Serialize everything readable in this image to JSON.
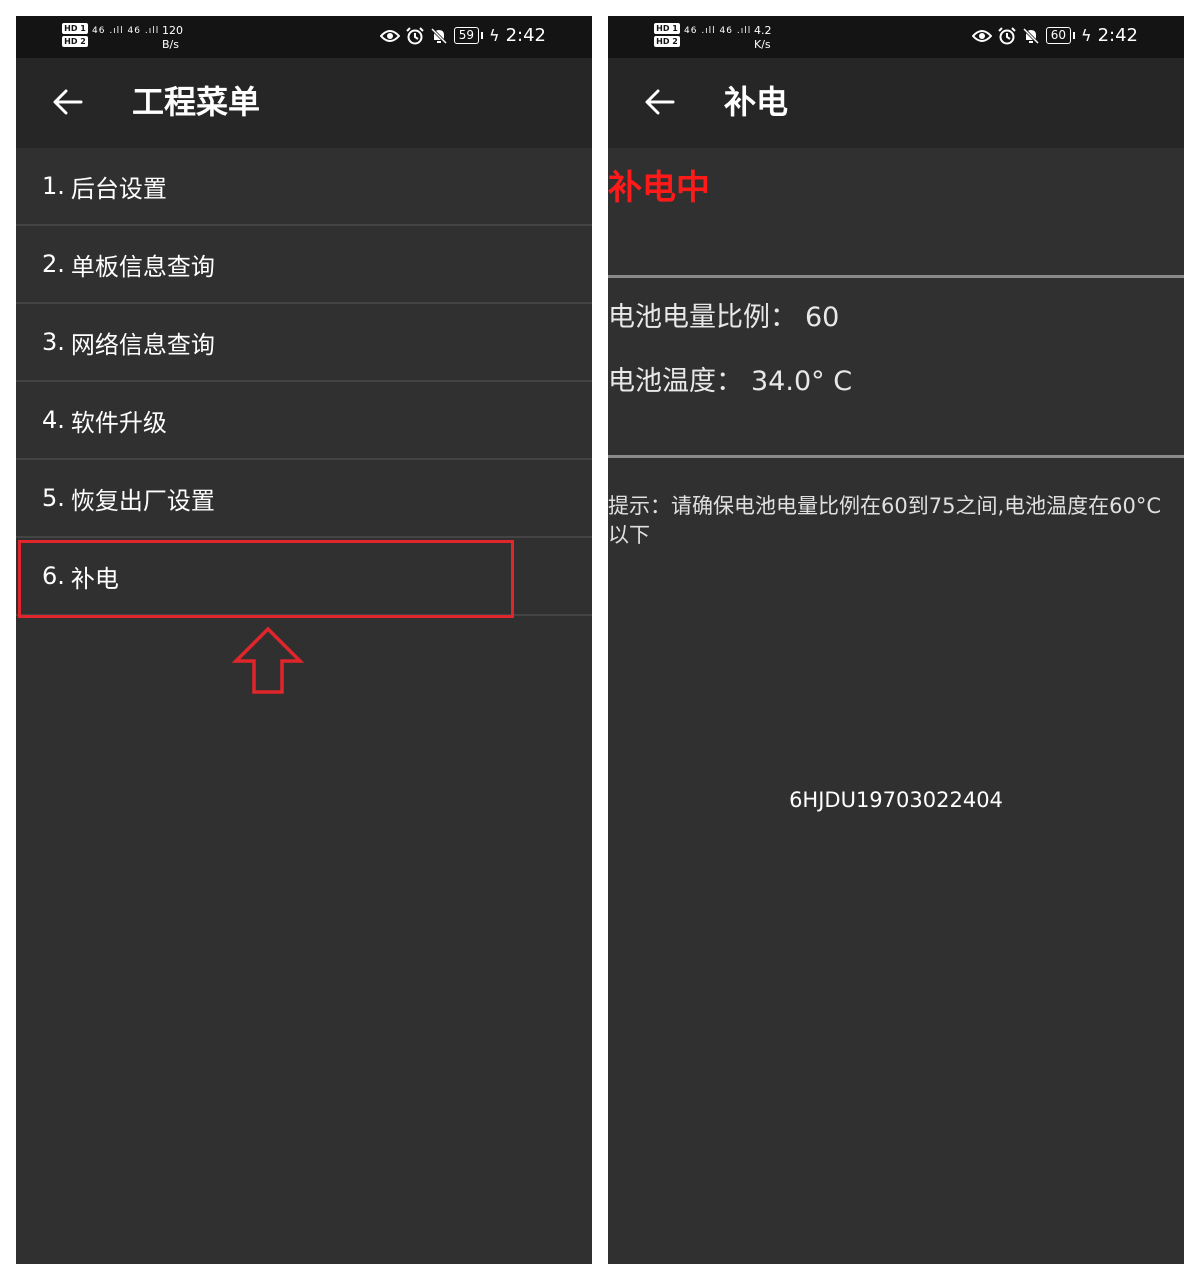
{
  "left": {
    "status_bar": {
      "hd1": "HD 1",
      "hd2": "HD 2",
      "signal": "46 .ıll 46 .ıll",
      "speed_value": "120",
      "speed_unit": "B/s",
      "icons": [
        "eye-icon",
        "alarm-icon",
        "mute-icon"
      ],
      "battery": "59",
      "time": "2:42"
    },
    "app_bar": {
      "title": "工程菜单"
    },
    "menu": [
      {
        "num": "1.",
        "label": "后台设置"
      },
      {
        "num": "2.",
        "label": "单板信息查询"
      },
      {
        "num": "3.",
        "label": "网络信息查询"
      },
      {
        "num": "4.",
        "label": "软件升级"
      },
      {
        "num": "5.",
        "label": "恢复出厂设置"
      },
      {
        "num": "6.",
        "label": "补电"
      }
    ]
  },
  "right": {
    "status_bar": {
      "hd1": "HD 1",
      "hd2": "HD 2",
      "signal": "46 .ıll 46 .ıll",
      "speed_value": "4.2",
      "speed_unit": "K/s",
      "icons": [
        "eye-icon",
        "alarm-icon",
        "mute-icon"
      ],
      "battery": "60",
      "time": "2:42"
    },
    "app_bar": {
      "title": "补电"
    },
    "status_text": "补电中",
    "battery_level": {
      "label": "电池电量比例：",
      "value": "60"
    },
    "battery_temp": {
      "label": "电池温度：",
      "value": "34.0° C"
    },
    "hint": "提示：请确保电池电量比例在60到75之间,电池温度在60°C以下",
    "serial": "6HJDU19703022404"
  },
  "colors": {
    "background": "#303030",
    "status_bar": "#141414",
    "app_bar": "#262626",
    "highlight": "#e0262a",
    "status_text": "#ff1a1a"
  }
}
